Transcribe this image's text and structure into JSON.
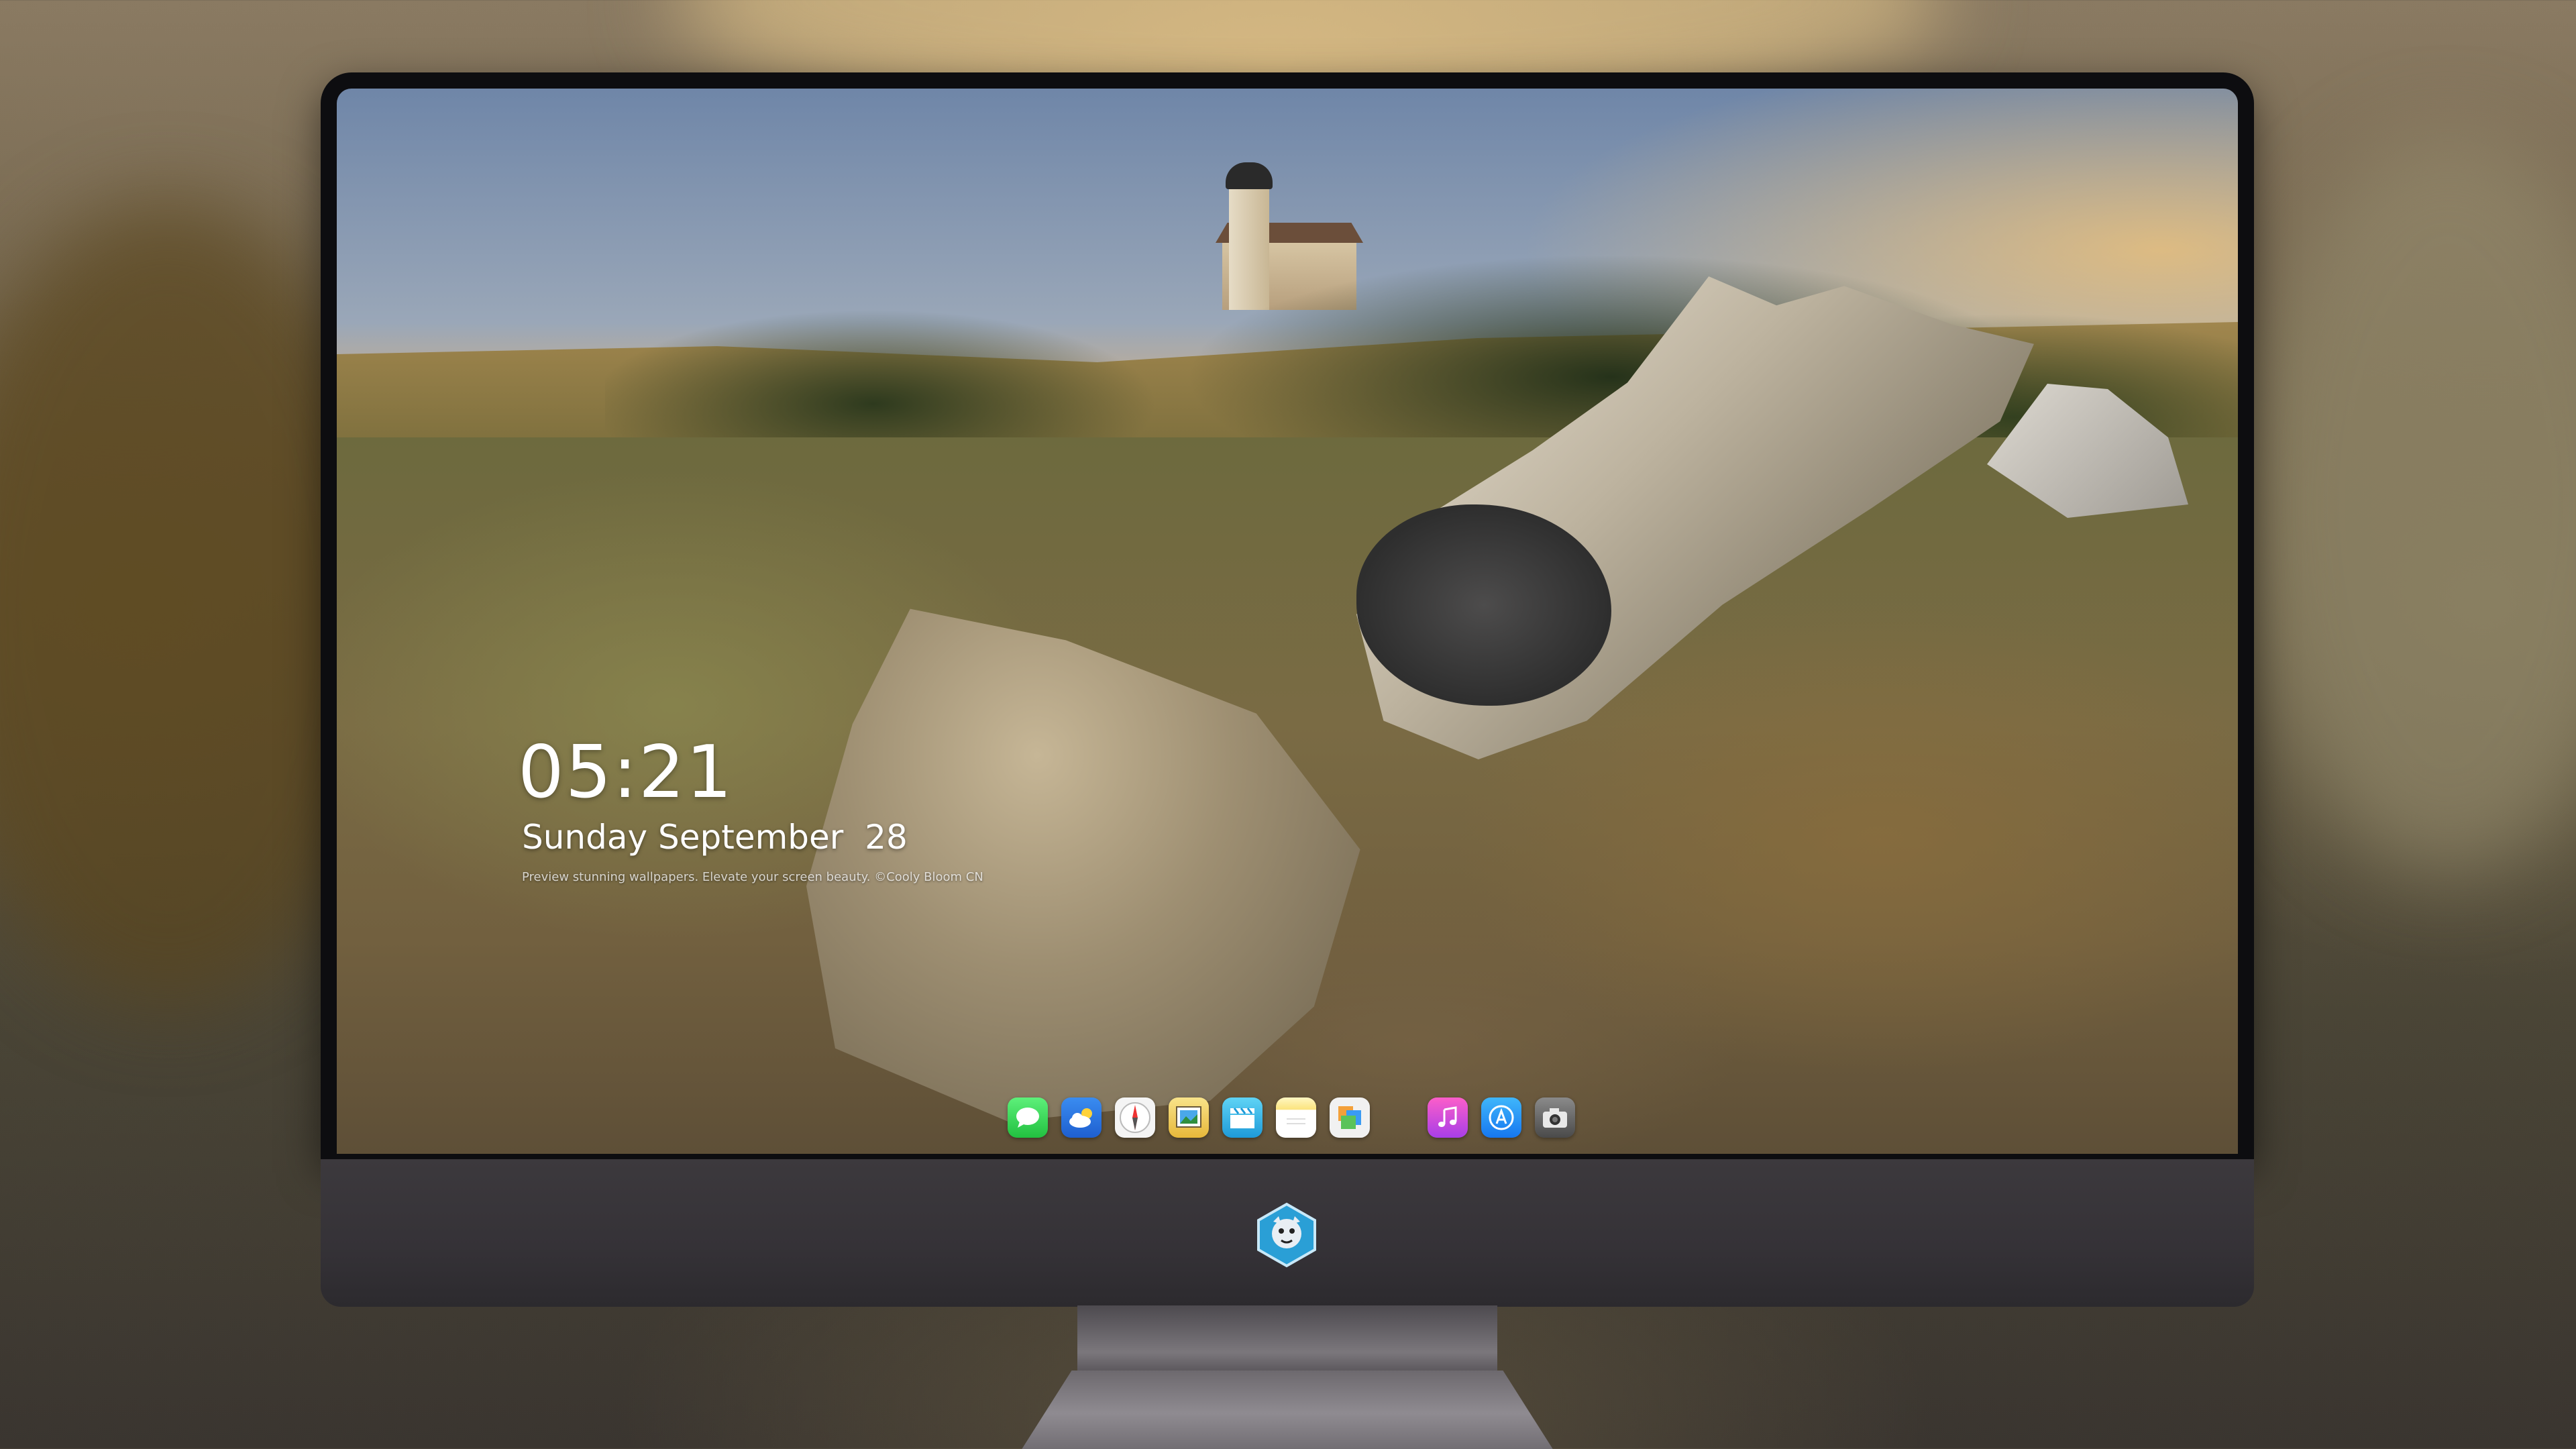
{
  "lock_screen": {
    "time": "05:21",
    "date": "Sunday September  28",
    "tagline": "Preview stunning wallpapers. Elevate your screen beauty. ©Cooly Bloom CN"
  },
  "dock": {
    "items": [
      {
        "name": "messages",
        "icon": "speech-bubble-icon"
      },
      {
        "name": "weather",
        "icon": "cloud-icon"
      },
      {
        "name": "safari",
        "icon": "compass-icon"
      },
      {
        "name": "preview",
        "icon": "picture-frame-icon"
      },
      {
        "name": "claquette",
        "icon": "clapperboard-icon"
      },
      {
        "name": "notes",
        "icon": "notepad-icon"
      },
      {
        "name": "photos",
        "icon": "photo-stack-icon"
      },
      {
        "name": "music",
        "icon": "music-note-icon"
      },
      {
        "name": "app-store",
        "icon": "app-store-icon"
      },
      {
        "name": "camera",
        "icon": "camera-icon"
      }
    ]
  },
  "colors": {
    "bezel": "#0d0d10",
    "chin": "#3c393d",
    "clock_text": "#ffffff"
  }
}
